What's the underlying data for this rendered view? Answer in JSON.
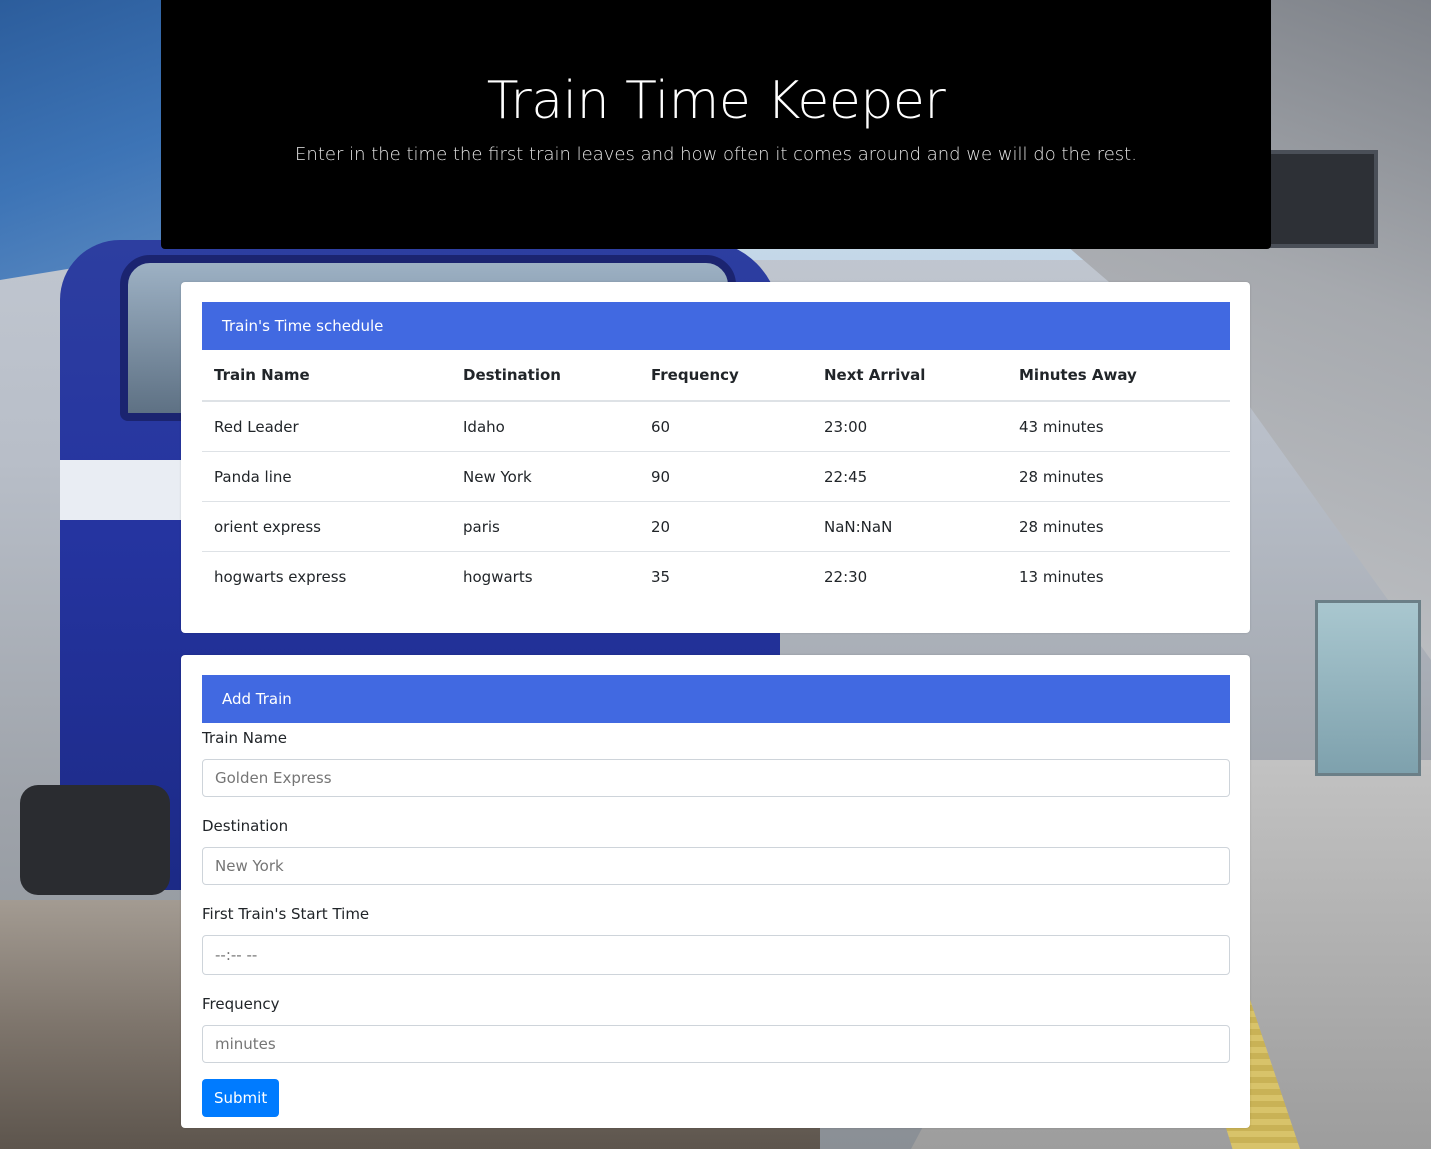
{
  "header": {
    "title": "Train Time Keeper",
    "subtitle": "Enter in the time the first train leaves and how often it comes around and we will do the rest."
  },
  "schedule": {
    "heading": "Train's Time schedule",
    "columns": [
      "Train Name",
      "Destination",
      "Frequency",
      "Next Arrival",
      "Minutes Away"
    ],
    "rows": [
      [
        "Red Leader",
        "Idaho",
        "60",
        "23:00",
        "43 minutes"
      ],
      [
        "Panda line",
        "New York",
        "90",
        "22:45",
        "28 minutes"
      ],
      [
        "orient express",
        "paris",
        "20",
        "NaN:NaN",
        "28 minutes"
      ],
      [
        "hogwarts express",
        "hogwarts",
        "35",
        "22:30",
        "13 minutes"
      ]
    ]
  },
  "add_train": {
    "heading": "Add Train",
    "fields": [
      {
        "label": "Train Name",
        "placeholder": "Golden Express"
      },
      {
        "label": "Destination",
        "placeholder": "New York"
      },
      {
        "label": "First Train's Start Time",
        "placeholder": "--:-- --"
      },
      {
        "label": "Frequency",
        "placeholder": "minutes"
      }
    ],
    "submit_label": "Submit"
  },
  "colors": {
    "card_header": "#4169e1",
    "submit_button": "#007bff",
    "header_bg": "#000000"
  }
}
